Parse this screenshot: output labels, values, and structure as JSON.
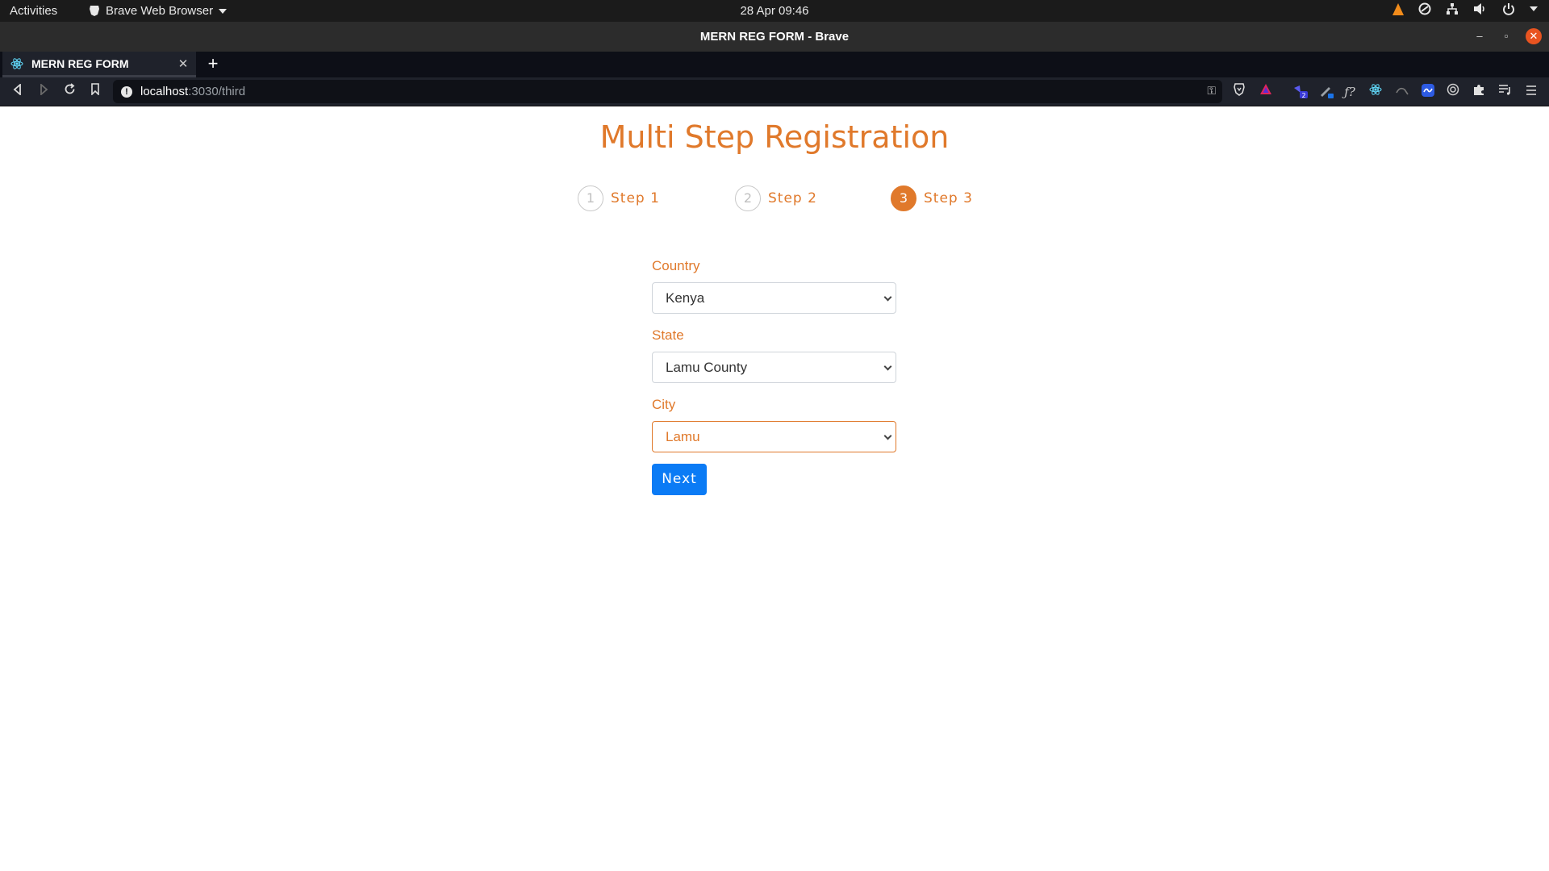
{
  "system_bar": {
    "activities": "Activities",
    "app_menu": "Brave Web Browser",
    "clock": "28 Apr  09:46"
  },
  "window": {
    "title": "MERN REG FORM - Brave"
  },
  "browser": {
    "tab_title": "MERN REG FORM",
    "url_host": "localhost",
    "url_rest": ":3030/third"
  },
  "page": {
    "heading": "Multi Step Registration",
    "steps": [
      {
        "number": "1",
        "label": "Step 1"
      },
      {
        "number": "2",
        "label": "Step 2"
      },
      {
        "number": "3",
        "label": "Step 3"
      }
    ],
    "active_step": 3,
    "fields": {
      "country": {
        "label": "Country",
        "value": "Kenya"
      },
      "state": {
        "label": "State",
        "value": "Lamu County"
      },
      "city": {
        "label": "City",
        "value": "Lamu"
      }
    },
    "next_label": "Next"
  },
  "colors": {
    "accent": "#e0792b",
    "button": "#0b7bf5"
  }
}
